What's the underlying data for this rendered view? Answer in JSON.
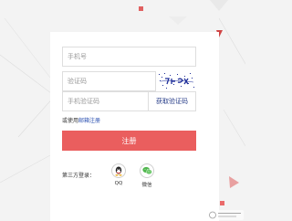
{
  "form": {
    "phone_placeholder": "手机号",
    "captcha_placeholder": "验证码",
    "sms_code_placeholder": "手机验证码",
    "get_code_label": "获取验证码",
    "email_prefix": "或使用",
    "email_link": "邮箱注册",
    "register_label": "注册"
  },
  "third_party": {
    "label": "第三方登录：",
    "qq_label": "QQ",
    "wechat_label": "微信"
  },
  "colors": {
    "accent": "#ea5e5e",
    "link": "#2a4fb0",
    "qq_icon": "#222222",
    "wechat_icon": "#4fb64d"
  },
  "icons": [
    "qq-icon",
    "wechat-icon",
    "captcha-image",
    "watermark-logo"
  ]
}
